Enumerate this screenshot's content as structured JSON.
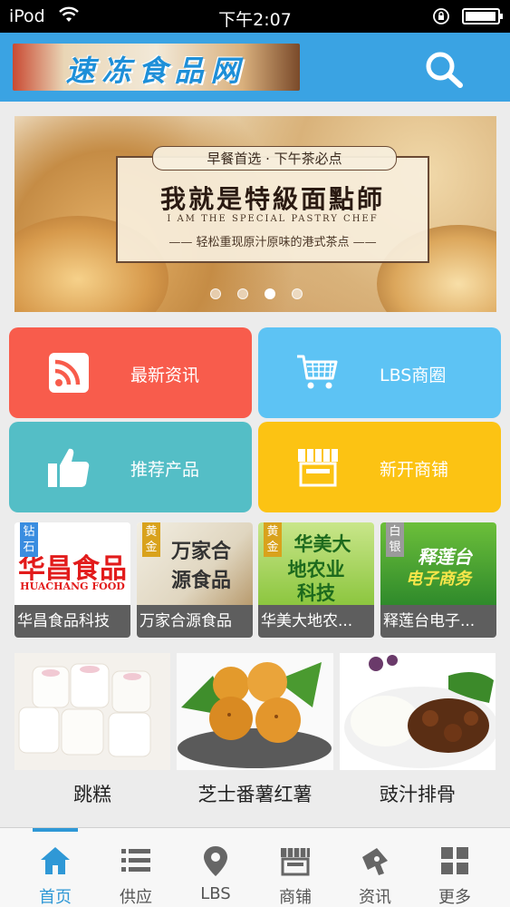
{
  "status_bar": {
    "carrier": "iPod",
    "time": "下午2:07"
  },
  "header": {
    "logo_text": "速冻食品网",
    "search_icon": "search-icon",
    "color": "#3aa3e3"
  },
  "banner": {
    "tagline": "早餐首选 · 下午茶必点",
    "title": "我就是特級面點師",
    "title_en": "I AM THE SPECIAL PASTRY CHEF",
    "subtitle": "—— 轻松重现原汁原味的港式茶点 ——",
    "slides": 4,
    "active_slide": 3
  },
  "tiles": [
    {
      "label": "最新资讯",
      "icon": "rss-icon",
      "color": "#f85c4c"
    },
    {
      "label": "LBS商圈",
      "icon": "cart-icon",
      "color": "#5dc3f4"
    },
    {
      "label": "推荐产品",
      "icon": "thumbs-up-icon",
      "color": "#54bec6"
    },
    {
      "label": "新开商铺",
      "icon": "storefront-icon",
      "color": "#fcc313"
    }
  ],
  "sellers": [
    {
      "name": "华昌食品科技",
      "badge": "钻石",
      "img_text": "华昌食品",
      "img_sub": "HUACHANG FOOD"
    },
    {
      "name": "万家合源食品",
      "badge": "黄金",
      "img_text": "万家合",
      "img_text2": "源食品"
    },
    {
      "name": "华美大地农...",
      "badge": "黄金",
      "img_text": "华美大",
      "img_text2": "地农业",
      "img_text3": "科技"
    },
    {
      "name": "释莲台电子...",
      "badge": "白银",
      "img_text": "释莲台",
      "img_text2": "电子商务"
    }
  ],
  "products": [
    {
      "name": "跳糕"
    },
    {
      "name": "芝士番薯红薯"
    },
    {
      "name": "豉汁排骨"
    }
  ],
  "tabbar": {
    "active_color": "#2f98d6",
    "items": [
      {
        "label": "首页",
        "icon": "home-icon"
      },
      {
        "label": "供应",
        "icon": "list-icon"
      },
      {
        "label": "LBS",
        "icon": "location-pin-icon"
      },
      {
        "label": "商铺",
        "icon": "store-icon"
      },
      {
        "label": "资讯",
        "icon": "news-icon"
      },
      {
        "label": "更多",
        "icon": "grid-icon"
      }
    ]
  }
}
